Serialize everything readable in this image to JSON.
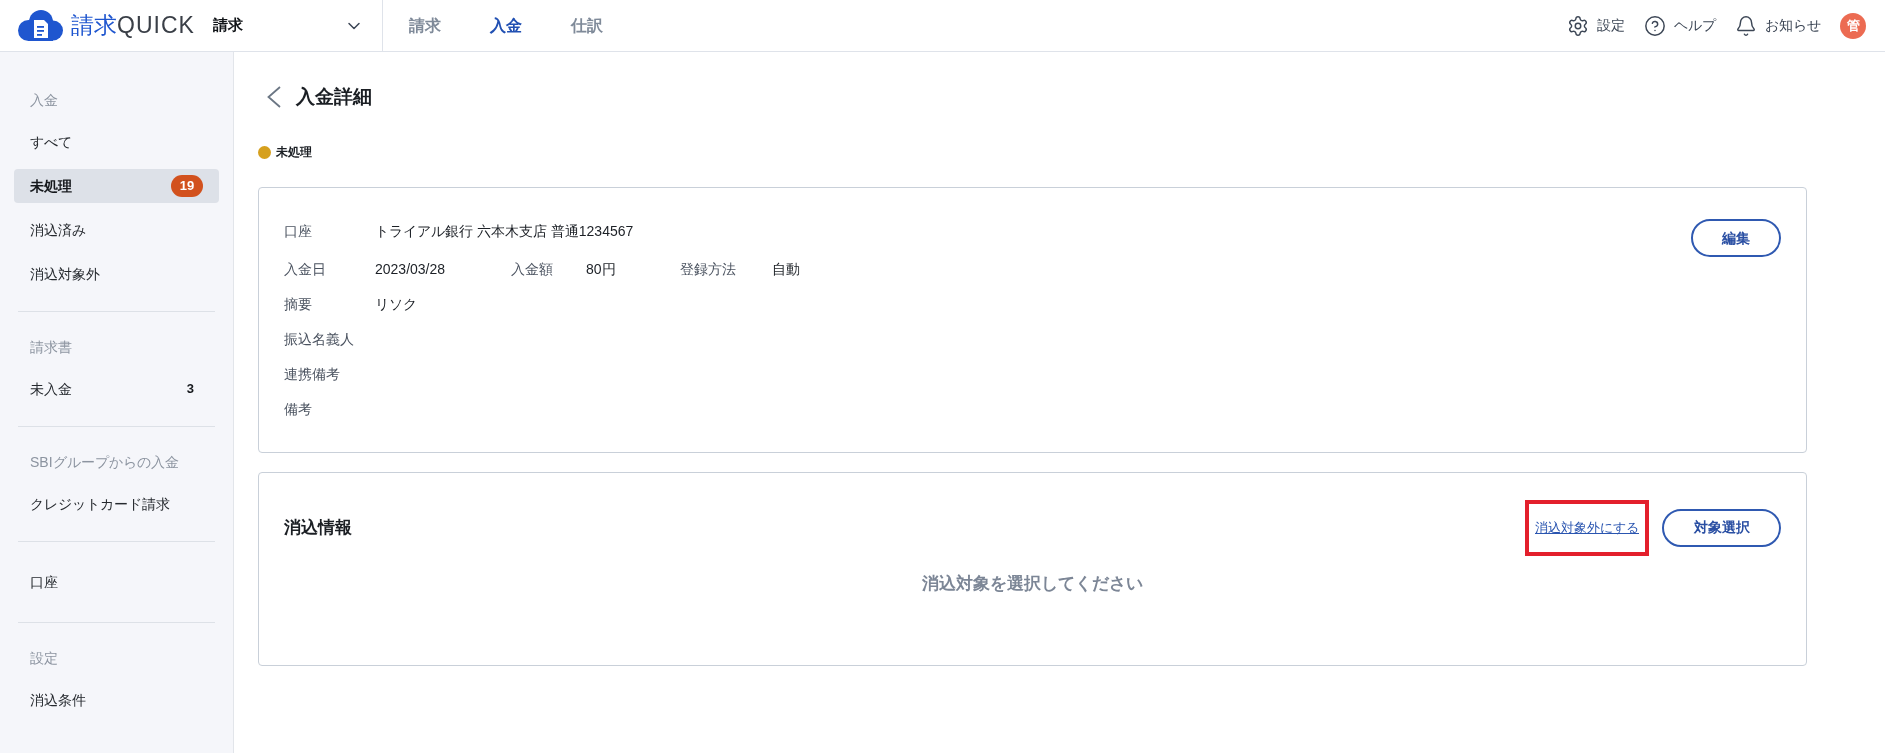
{
  "header": {
    "logo": {
      "kanji": "請求",
      "latin": "QUICK"
    },
    "app_switcher": {
      "label": "請求"
    },
    "nav_tabs": [
      {
        "label": "請求",
        "selected": false
      },
      {
        "label": "入金",
        "selected": true
      },
      {
        "label": "仕訳",
        "selected": false
      }
    ],
    "actions": [
      {
        "kind": "settings",
        "label": "設定"
      },
      {
        "kind": "help",
        "label": "ヘルプ"
      },
      {
        "kind": "notifications",
        "label": "お知らせ"
      }
    ],
    "avatar": {
      "initial": "管"
    }
  },
  "sidebar": {
    "sections": [
      {
        "heading": "入金",
        "items": [
          {
            "label": "すべて",
            "selected": false
          },
          {
            "label": "未処理",
            "selected": true,
            "badge": "19"
          },
          {
            "label": "消込済み",
            "selected": false
          },
          {
            "label": "消込対象外",
            "selected": false
          }
        ]
      },
      {
        "heading": "請求書",
        "items": [
          {
            "label": "未入金",
            "selected": false,
            "count": "3"
          }
        ]
      },
      {
        "heading": "SBIグループからの入金",
        "items": [
          {
            "label": "クレジットカード請求",
            "selected": false
          }
        ]
      },
      {
        "items": [
          {
            "label": "口座",
            "selected": false
          }
        ]
      },
      {
        "heading": "設定",
        "items": [
          {
            "label": "消込条件",
            "selected": false
          }
        ]
      }
    ]
  },
  "page": {
    "title": "入金詳細",
    "status": {
      "label": "未処理",
      "color": "#d6a01e"
    }
  },
  "detail_card": {
    "rows": [
      {
        "fields": [
          {
            "label": "口座",
            "value": "トライアル銀行 六本木支店 普通1234567"
          }
        ]
      },
      {
        "fields": [
          {
            "label": "入金日",
            "value": "2023/03/28"
          },
          {
            "label": "入金額",
            "value": "80円"
          },
          {
            "label": "登録方法",
            "value": "自動"
          }
        ]
      },
      {
        "fields": [
          {
            "label": "摘要",
            "value": "リソク"
          }
        ]
      },
      {
        "fields": [
          {
            "label": "振込名義人"
          }
        ]
      },
      {
        "fields": [
          {
            "label": "連携備考"
          }
        ]
      },
      {
        "fields": [
          {
            "label": "備考"
          }
        ]
      }
    ],
    "edit_button": "編集"
  },
  "reconcile_card": {
    "title": "消込情報",
    "exclude_link": {
      "label": "消込対象外にする",
      "highlighted": true
    },
    "select_button": "対象選択",
    "empty_message": "消込対象を選択してください"
  }
}
